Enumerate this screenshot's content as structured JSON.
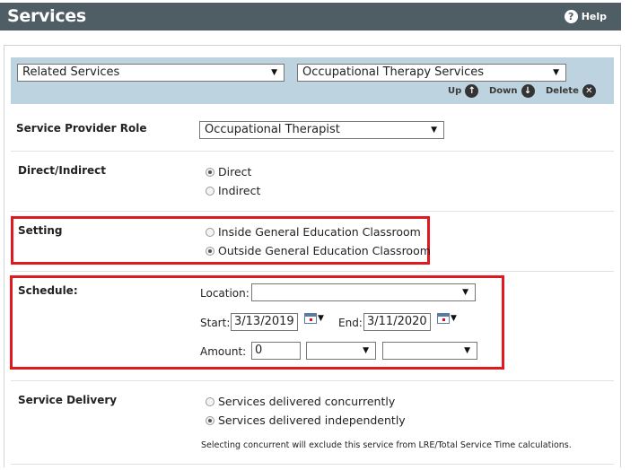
{
  "header": {
    "title": "Services",
    "help_label": "Help",
    "help_icon": "question-circle-icon"
  },
  "service_selectors": {
    "category": "Related Services",
    "service": "Occupational Therapy Services",
    "controls": {
      "up_label": "Up",
      "down_label": "Down",
      "delete_label": "Delete"
    }
  },
  "provider_role": {
    "label": "Service Provider Role",
    "value": "Occupational Therapist"
  },
  "direct_indirect": {
    "label": "Direct/Indirect",
    "options": [
      {
        "label": "Direct",
        "checked": true
      },
      {
        "label": "Indirect",
        "checked": false
      }
    ]
  },
  "setting": {
    "label": "Setting",
    "options": [
      {
        "label": "Inside General Education Classroom",
        "checked": false
      },
      {
        "label": "Outside General Education Classroom",
        "checked": true
      }
    ]
  },
  "schedule": {
    "label": "Schedule:",
    "location_label": "Location:",
    "location_value": "",
    "start_label": "Start:",
    "start_value": "3/13/2019",
    "end_label": "End:",
    "end_value": "3/11/2020",
    "amount_label": "Amount:",
    "amount_value": "0",
    "frequency_value": "",
    "period_value": ""
  },
  "service_delivery": {
    "label": "Service Delivery",
    "options": [
      {
        "label": "Services delivered concurrently",
        "checked": false
      },
      {
        "label": "Services delivered independently",
        "checked": true
      }
    ],
    "note": "Selecting concurrent will exclude this service from LRE/Total Service Time calculations."
  },
  "colors": {
    "header_bg": "#4f5d64",
    "selector_bar_bg": "#bed3e0",
    "highlight_border": "#e0191f"
  }
}
